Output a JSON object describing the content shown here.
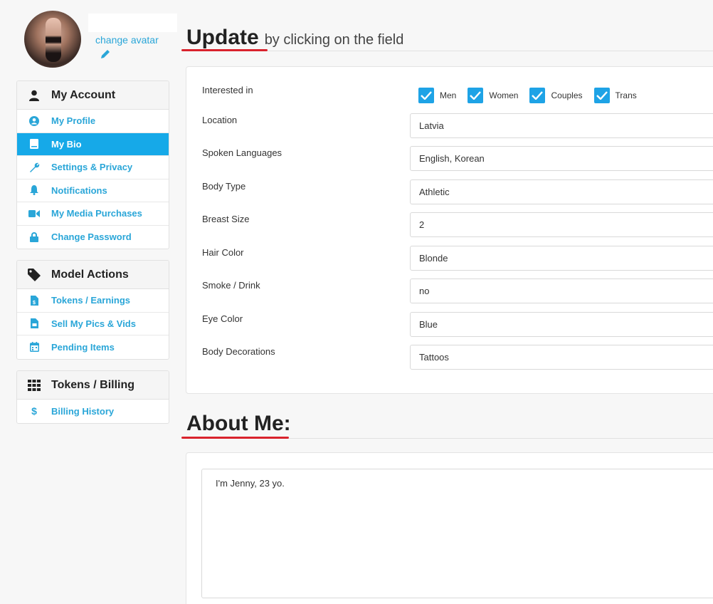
{
  "profile": {
    "change_avatar": "change avatar"
  },
  "sidebar": {
    "account": {
      "title": "My Account",
      "items": [
        {
          "label": "My Profile",
          "icon": "user-circle-icon"
        },
        {
          "label": "My Bio",
          "icon": "book-icon",
          "active": true
        },
        {
          "label": "Settings & Privacy",
          "icon": "wrench-icon"
        },
        {
          "label": "Notifications",
          "icon": "bell-icon"
        },
        {
          "label": "My Media Purchases",
          "icon": "video-icon"
        },
        {
          "label": "Change Password",
          "icon": "lock-icon"
        }
      ]
    },
    "model": {
      "title": "Model Actions",
      "items": [
        {
          "label": "Tokens / Earnings",
          "icon": "token-file-icon"
        },
        {
          "label": "Sell My Pics & Vids",
          "icon": "image-file-icon"
        },
        {
          "label": "Pending Items",
          "icon": "calendar-icon"
        }
      ]
    },
    "billing": {
      "title": "Tokens / Billing",
      "items": [
        {
          "label": "Billing History",
          "icon": "dollar-icon"
        }
      ]
    }
  },
  "header": {
    "update_big": "Update",
    "update_small": "by clicking on the field",
    "about": "About Me:"
  },
  "form": {
    "interested_label": "Interested in",
    "interested_options": [
      "Men",
      "Women",
      "Couples",
      "Trans"
    ],
    "fields": [
      {
        "label": "Location",
        "value": "Latvia"
      },
      {
        "label": "Spoken Languages",
        "value": "English, Korean"
      },
      {
        "label": "Body Type",
        "value": "Athletic"
      },
      {
        "label": "Breast Size",
        "value": "2"
      },
      {
        "label": "Hair Color",
        "value": "Blonde"
      },
      {
        "label": "Smoke / Drink",
        "value": "no"
      },
      {
        "label": "Eye Color",
        "value": "Blue"
      },
      {
        "label": "Body Decorations",
        "value": "Tattoos"
      }
    ]
  },
  "about": {
    "text": "I'm Jenny, 23 yo."
  },
  "colors": {
    "accent": "#16a9e8",
    "link": "#2aa6d8",
    "underline": "#d9232d"
  }
}
